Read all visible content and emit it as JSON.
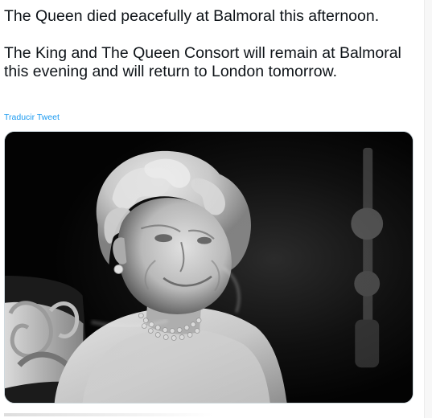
{
  "tweet": {
    "paragraph_1": "The Queen died peacefully at Balmoral this afternoon.",
    "paragraph_2": "The King and The Queen Consort will remain at Balmoral this evening and will return to London tomorrow.",
    "translate_label": "Traducir Tweet"
  },
  "colors": {
    "text": "#0f1419",
    "link": "#1d9bf0",
    "media_border": "#cfd9de"
  },
  "icons": {
    "media": "photograph-of-queen"
  }
}
